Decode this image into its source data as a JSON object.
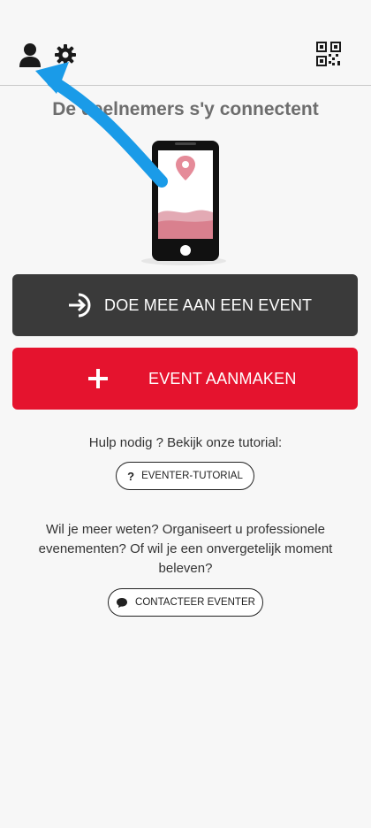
{
  "topbar": {
    "profile_icon": "person-icon",
    "settings_icon": "gear-icon",
    "qr_icon": "qr-code-icon"
  },
  "main": {
    "headline": "De deelnemers s'y connectent",
    "illustration": "phone-with-location-pin",
    "join_button": "DOE MEE AAN EEN EVENT",
    "create_button": "EVENT AANMAKEN",
    "help_text": "Hulp nodig ? Bekijk onze tutorial:",
    "tutorial_button": "EVENTER-TUTORIAL",
    "info_text": "Wil je meer weten? Organiseert u professionele evenementen? Of wil je een onvergetelijk moment beleven?",
    "contact_button": "CONTACTEER EVENTER"
  },
  "colors": {
    "join_bg": "#3a3a3a",
    "create_bg": "#e5132e",
    "accent_pink": "#d9808e",
    "annotation_arrow": "#1a9be8"
  }
}
